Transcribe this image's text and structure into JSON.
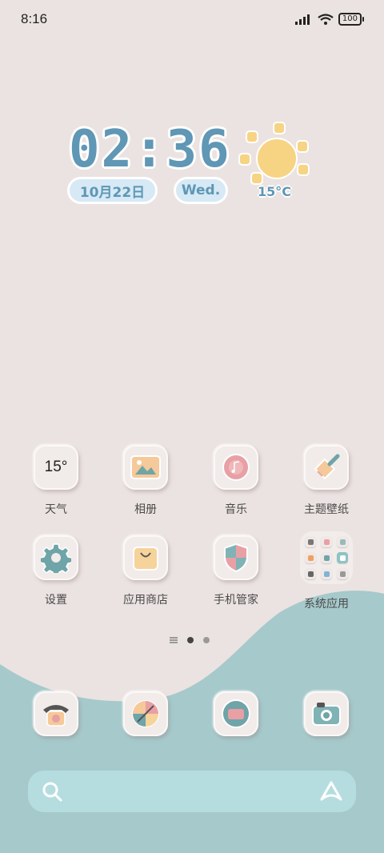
{
  "status_bar": {
    "time": "8:16",
    "battery": "100"
  },
  "clock_widget": {
    "time": "02:36",
    "date": "10月22日",
    "weekday": "Wed.",
    "temperature": "15°C"
  },
  "apps_row1": [
    {
      "label": "天气",
      "icon": "weather-icon",
      "badge_text": "15°"
    },
    {
      "label": "相册",
      "icon": "gallery-icon"
    },
    {
      "label": "音乐",
      "icon": "music-icon"
    },
    {
      "label": "主题壁纸",
      "icon": "themes-brush-icon"
    }
  ],
  "apps_row2": [
    {
      "label": "设置",
      "icon": "settings-gear-icon"
    },
    {
      "label": "应用商店",
      "icon": "app-store-bag-icon"
    },
    {
      "label": "手机管家",
      "icon": "security-shield-icon"
    },
    {
      "label": "系统应用",
      "icon": "system-apps-folder-icon"
    }
  ],
  "dock": [
    {
      "icon": "phone-icon"
    },
    {
      "icon": "browser-icon"
    },
    {
      "icon": "messages-icon"
    },
    {
      "icon": "camera-icon"
    }
  ],
  "colors": {
    "background": "#ebe3e1",
    "wave": "#a6c9cb",
    "accent_blue": "#5f97b5",
    "search_bar": "#b5dde0"
  }
}
